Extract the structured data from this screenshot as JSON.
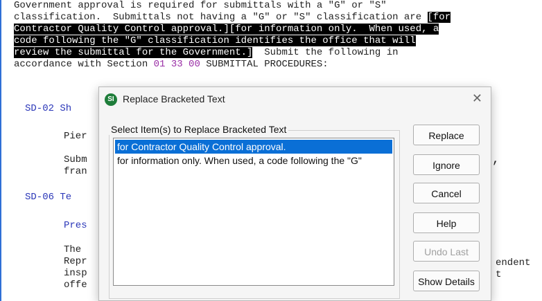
{
  "document": {
    "lines": [
      {
        "pre": "Government approval is required for submittals with a \"G\" or \"S\""
      },
      {
        "pre": "classification.  Submittals not having a \"G\" or \"S\" classification are ",
        "hl": "[for"
      },
      {
        "hl": "Contractor Quality Control approval.][for information only.  When used, a"
      },
      {
        "hl": "code following the \"G\" classification identifies the office that will"
      },
      {
        "hl": "review the submittal for the Government.]",
        "post": "  Submit the following in"
      },
      {
        "pre": "accordance with Section ",
        "section": "01 33 00",
        "post": " SUBMITTAL PROCEDURES:"
      }
    ],
    "frag": {
      "sd02": "SD-02 Sh",
      "pier": "Pier",
      "subm": "Subm",
      "fran": "fran",
      "sd06": "SD-06 Te",
      "pres": "Pres",
      "the": "The",
      "repr": "Repr",
      "insp": "insp",
      "offe": "offe",
      "comma": ",",
      "endent": "endent",
      "t": "t"
    }
  },
  "dialog": {
    "title": "Replace Bracketed Text",
    "icon_glyph": "SI",
    "close_glyph": "✕",
    "group_label": "Select Item(s) to Replace Bracketed Text",
    "items": [
      "for Contractor Quality Control approval.",
      "for information only.  When used, a code following the \"G\""
    ],
    "buttons": {
      "replace": "Replace",
      "ignore": "Ignore",
      "cancel": "Cancel",
      "help": "Help",
      "undo_last": "Undo Last",
      "show_details": "Show Details"
    }
  }
}
